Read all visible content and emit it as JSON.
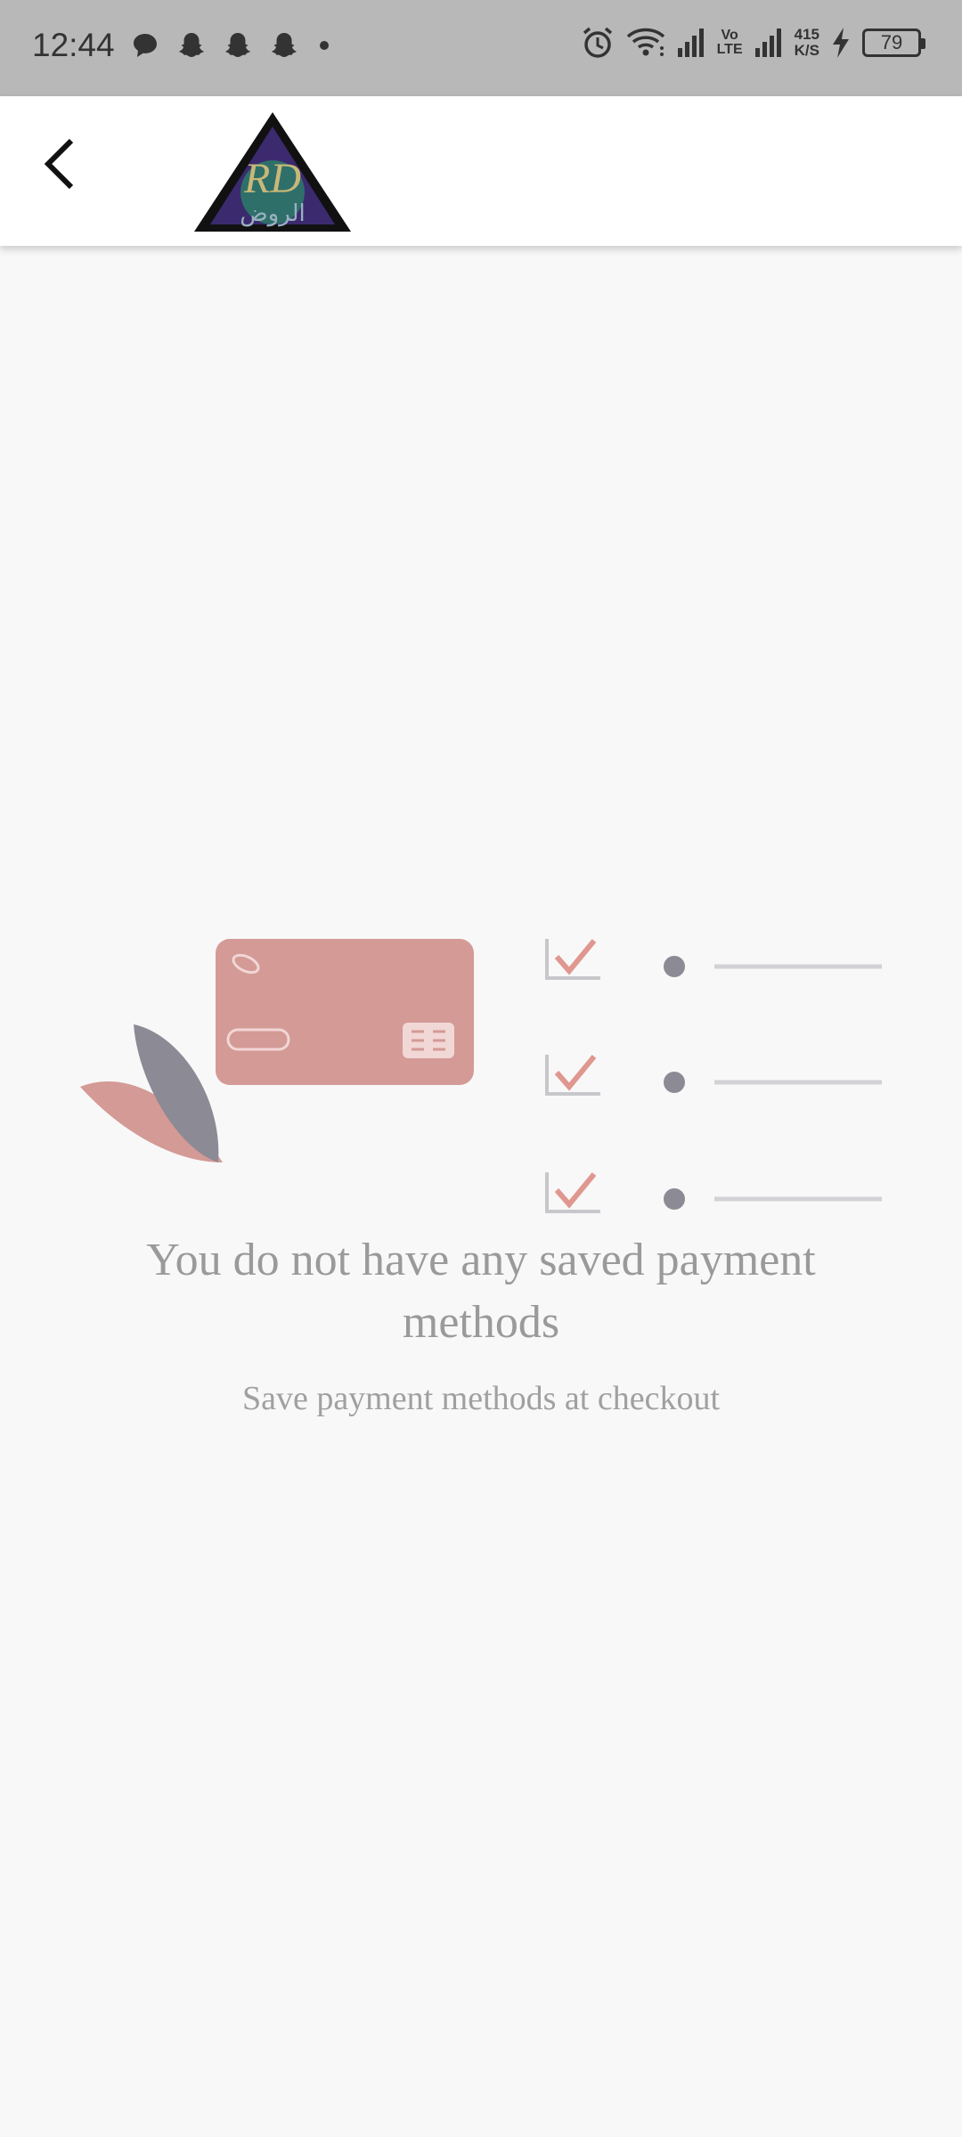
{
  "status_bar": {
    "time": "12:44",
    "network_speed_value": "415",
    "network_speed_unit": "K/S",
    "volte_top": "Vo",
    "volte_bottom": "LTE",
    "battery_level": "79",
    "left_icons": [
      "chat-icon",
      "snapchat-icon",
      "snapchat-icon",
      "snapchat-icon",
      "dot-icon"
    ],
    "right_icons": [
      "alarm-icon",
      "wifi-icon",
      "signal-icon",
      "volte-icon",
      "signal-icon",
      "speed-indicator",
      "charging-icon",
      "battery-icon"
    ]
  },
  "app_bar": {
    "back_icon": "back-arrow-icon",
    "logo_letters": "RD",
    "logo_arabic": "الروض"
  },
  "empty_state": {
    "illustration": "credit-card-checklist-illustration",
    "title": "You do not have any saved payment methods",
    "subtitle": "Save payment methods at checkout"
  },
  "colors": {
    "status_bar_bg": "#b8b8b8",
    "app_bar_bg": "#ffffff",
    "page_bg": "#f8f8f8",
    "card_color": "#d49a96",
    "accent_dark": "#8c8a94",
    "text_gray": "#9a9a9a"
  }
}
